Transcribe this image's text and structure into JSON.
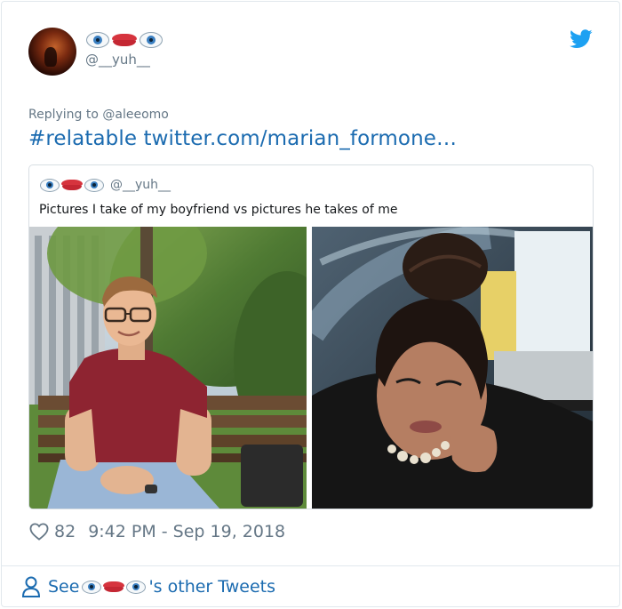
{
  "author": {
    "display_name_emojis": [
      "eye-emoji",
      "lips-emoji",
      "eye-emoji"
    ],
    "handle": "@__yuh__",
    "avatar_icon": "avatar-photo"
  },
  "brand": {
    "icon": "twitter-bird-icon",
    "color": "#1da1f2"
  },
  "reply": {
    "prefix": "Replying to ",
    "mention": "@aleeomo"
  },
  "tweet": {
    "text": "#relatable twitter.com/marian_formone…",
    "link_color": "#1b6bb0"
  },
  "quote": {
    "display_name_emojis": [
      "eye-emoji",
      "lips-emoji",
      "eye-emoji"
    ],
    "handle": "@__yuh__",
    "text": "Pictures I take of my boyfriend vs pictures he takes of me",
    "photos": [
      "photo-boyfriend-on-bench",
      "photo-girlfriend-low-angle"
    ]
  },
  "stats": {
    "likes": "82",
    "timestamp": "9:42 PM - Sep 19, 2018"
  },
  "footer": {
    "prefix": "See",
    "suffix": "'s other Tweets",
    "icon": "person-icon"
  }
}
